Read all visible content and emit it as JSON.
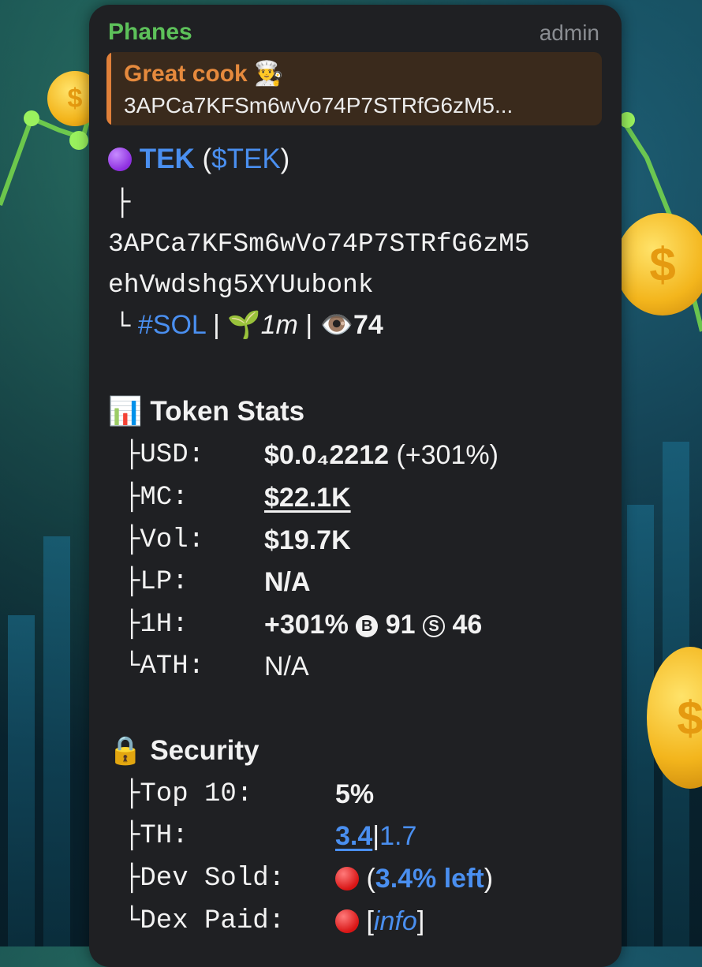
{
  "message": {
    "sender": "Phanes",
    "role": "admin",
    "reply": {
      "title": "Great cook 👨‍🍳",
      "text": "3APCa7KFSm6wVo74P7STRfG6zM5..."
    },
    "token": {
      "name": "TEK",
      "open": "(",
      "symbol": "$TEK",
      "close": ")",
      "tree_mid": "├",
      "address_line1": "3APCa7KFSm6wVo74P7STRfG6zM5",
      "address_line2": "ehVwdshg5XYUubonk",
      "tree_end": "└",
      "chain": "#SOL",
      "sep": "|",
      "age_icon": "🌱",
      "age": "1m",
      "views_icon": "👁️",
      "views": "74"
    },
    "stats": {
      "icon": "📊",
      "heading": "Token Stats",
      "usd": {
        "prefix": "├",
        "label": "USD:",
        "value": "$0.0₄2212",
        "change": "(+301%)"
      },
      "mc": {
        "prefix": "├",
        "label": "MC:",
        "value": "$22.1K"
      },
      "vol": {
        "prefix": "├",
        "label": "Vol:",
        "value": "$19.7K"
      },
      "lp": {
        "prefix": "├",
        "label": "LP:",
        "value": "N/A"
      },
      "h1": {
        "prefix": "├",
        "label": "1H:",
        "value": "+301%",
        "buy_letter": "B",
        "buys": "91",
        "sell_letter": "S",
        "sells": "46"
      },
      "ath": {
        "prefix": "└",
        "label": "ATH:",
        "value": "N/A"
      }
    },
    "security": {
      "icon": "🔒",
      "heading": "Security",
      "top10": {
        "prefix": "├",
        "label": "Top 10:",
        "value": "5%"
      },
      "th": {
        "prefix": "├",
        "label": "TH:",
        "value_link": "3.4",
        "sep": "|",
        "value2": "1.7"
      },
      "dev_sold": {
        "prefix": "├",
        "label": "Dev Sold:",
        "open": "(",
        "value": "3.4% left",
        "close": ")"
      },
      "dex_paid": {
        "prefix": "└",
        "label": "Dex Paid:",
        "open": "[",
        "link": "info",
        "close": "]"
      }
    }
  },
  "colors": {
    "bubble": "#1f2023",
    "sender": "#5dc15a",
    "reply_accent": "#e0803a",
    "link": "#4a8ff0"
  }
}
